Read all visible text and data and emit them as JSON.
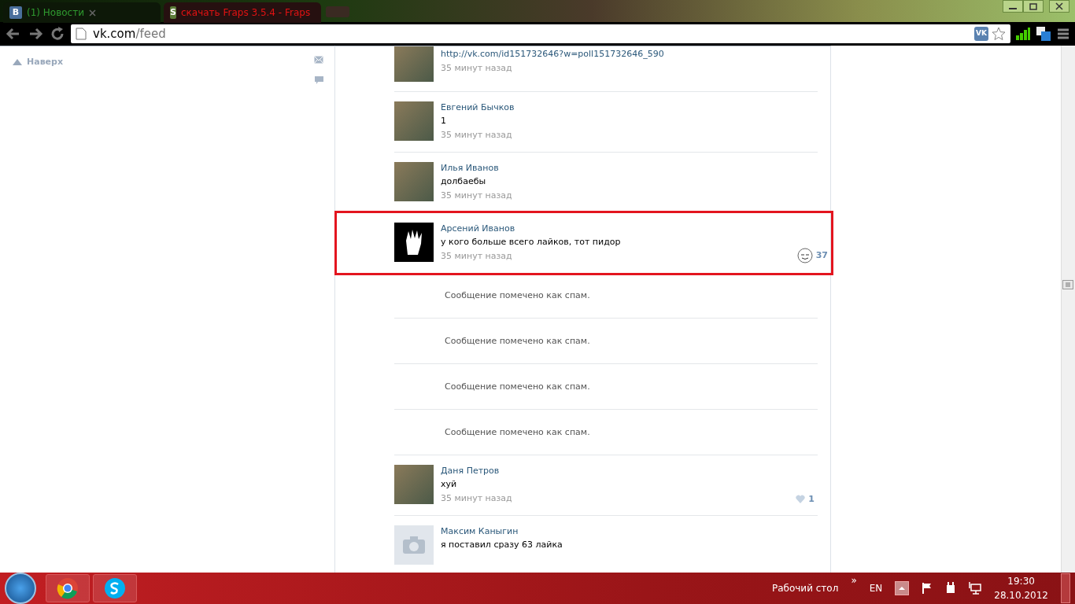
{
  "browser": {
    "tabs": [
      {
        "favicon": "В",
        "title": "(1) Новости",
        "selected": true
      },
      {
        "favicon": "S",
        "title": "скачать Fraps 3.5.4 - Fraps",
        "selected": false
      }
    ],
    "address": {
      "host": "vk.com",
      "path": "/feed"
    },
    "extension_badge": "VK"
  },
  "sidebar": {
    "back_to_top": "Наверх"
  },
  "feed": [
    {
      "kind": "comment",
      "text": "http://vk.com/id151732646?w=poll151732646_590",
      "link": true,
      "time": "35 минут назад",
      "highlighted": false,
      "avatar": {
        "kind": "photo"
      }
    },
    {
      "kind": "comment",
      "name": "Евгений Бычков",
      "text": "1",
      "link": false,
      "time": "35 минут назад",
      "highlighted": false,
      "avatar": {
        "kind": "photo"
      }
    },
    {
      "kind": "comment",
      "name": "Илья Иванов",
      "text": "долбаебы",
      "link": false,
      "time": "35 минут назад",
      "highlighted": false,
      "avatar": {
        "kind": "photo"
      }
    },
    {
      "kind": "comment",
      "name": "Арсений Иванов",
      "text": "у кого больше всего лайков, тот пидор",
      "link": false,
      "time": "35 минут назад",
      "highlighted": true,
      "avatar": {
        "kind": "artwork"
      },
      "like": {
        "kind": "face",
        "count": "37"
      }
    },
    {
      "kind": "spam",
      "text": "Сообщение помечено как спам."
    },
    {
      "kind": "spam",
      "text": "Сообщение помечено как спам."
    },
    {
      "kind": "spam",
      "text": "Сообщение помечено как спам."
    },
    {
      "kind": "spam",
      "text": "Сообщение помечено как спам."
    },
    {
      "kind": "comment",
      "name": "Даня Петров",
      "text": "хуй",
      "link": false,
      "time": "35 минут назад",
      "highlighted": false,
      "avatar": {
        "kind": "photo"
      },
      "like": {
        "kind": "heart",
        "count": "1"
      }
    },
    {
      "kind": "comment",
      "name": "Максим Каныгин",
      "text": "я поставил сразу 63 лайка",
      "link": false,
      "highlighted": false,
      "avatar": {
        "kind": "camera"
      }
    }
  ],
  "taskbar": {
    "desktop": "Рабочий стол",
    "overflow": "»",
    "language": "EN",
    "time": "19:30",
    "date": "28.10.2012"
  }
}
